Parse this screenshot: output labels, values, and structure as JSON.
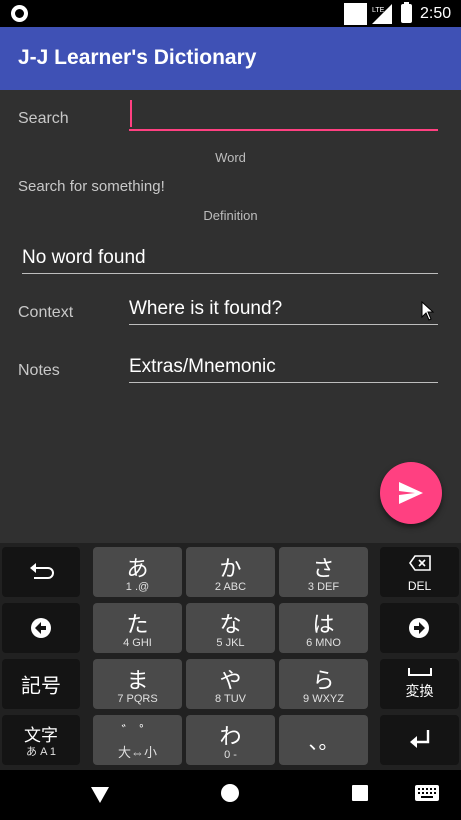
{
  "status_bar": {
    "time": "2:50",
    "network": "LTE"
  },
  "app_bar": {
    "title": "J-J Learner's Dictionary"
  },
  "form": {
    "search_label": "Search",
    "search_value": "",
    "word_label": "Word",
    "word_value": "Search for something!",
    "definition_label": "Definition",
    "definition_value": "No word found",
    "context_label": "Context",
    "context_value": "Where is it found?",
    "notes_label": "Notes",
    "notes_value": "Extras/Mnemonic"
  },
  "keyboard": {
    "keys": [
      {
        "main": "あ",
        "sub": "1    .@"
      },
      {
        "main": "か",
        "sub": "2    ABC"
      },
      {
        "main": "さ",
        "sub": "3    DEF"
      },
      {
        "main": "た",
        "sub": "4    GHI"
      },
      {
        "main": "な",
        "sub": "5    JKL"
      },
      {
        "main": "は",
        "sub": "6    MNO"
      },
      {
        "main": "ま",
        "sub": "7    PQRS"
      },
      {
        "main": "や",
        "sub": "8    TUV"
      },
      {
        "main": "ら",
        "sub": "9    WXYZ"
      },
      {
        "main": "゛ ゜",
        "sub": "大⇔小"
      },
      {
        "main": "わ",
        "sub": "0    -"
      },
      {
        "main": "、。",
        "sub": ""
      }
    ],
    "delete_label": "DEL",
    "symbols_label": "記号",
    "convert_label": "変換",
    "mode_label": "文字",
    "mode_sub": "あ A 1"
  }
}
